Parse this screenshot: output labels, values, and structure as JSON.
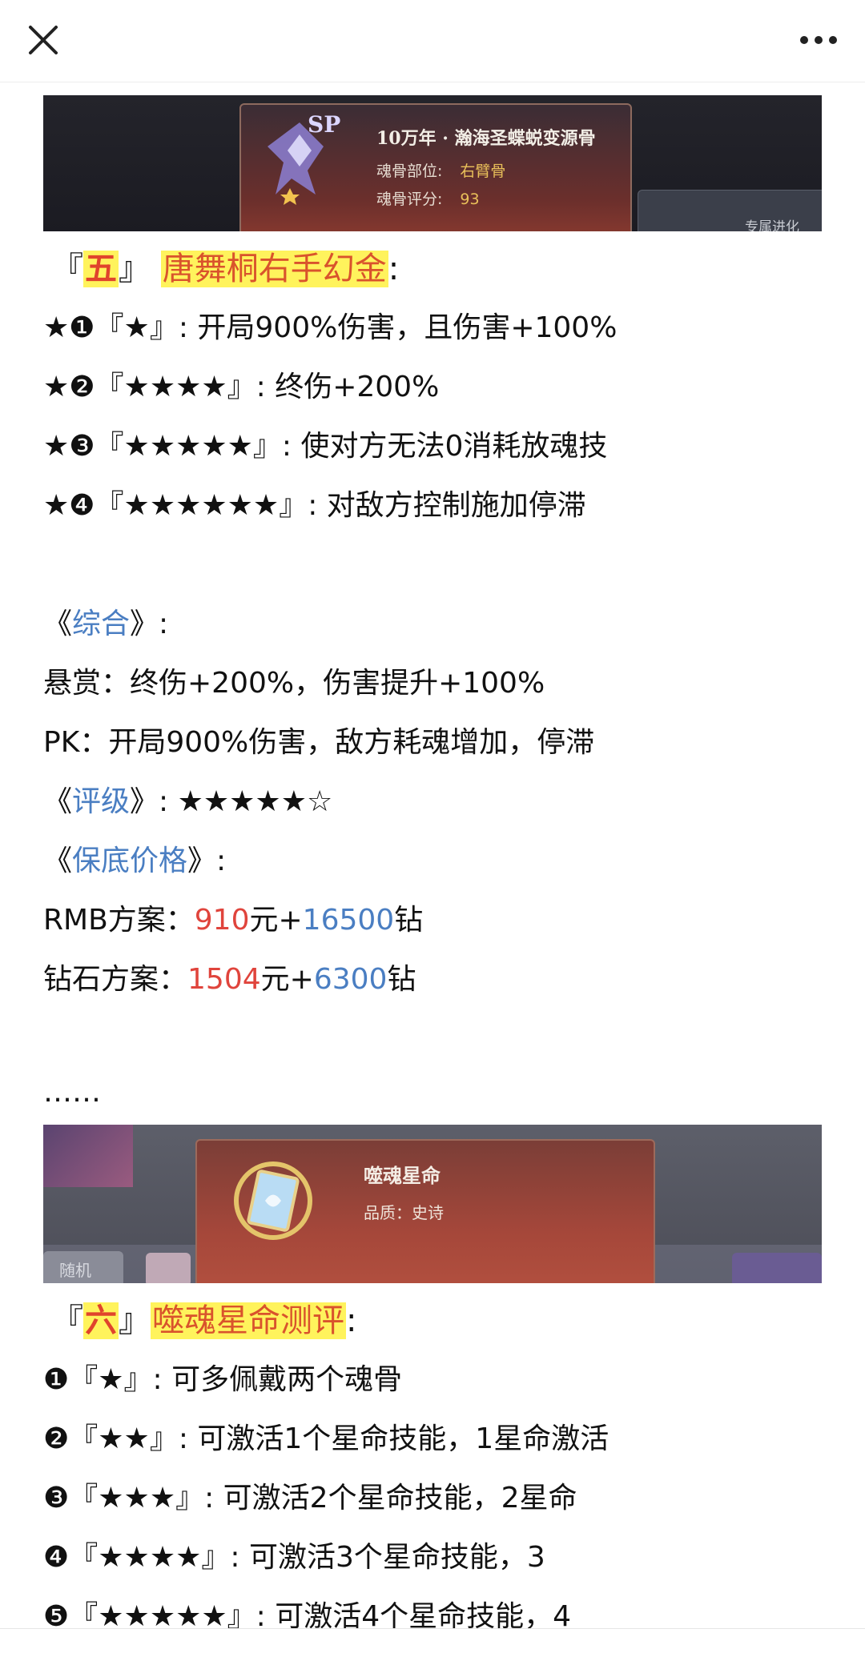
{
  "toolbar": {
    "close_icon": "close-icon",
    "more_icon": "more-icon"
  },
  "banner1": {
    "badge": "SP",
    "title": "10万年 · 瀚海圣蝶蜕变源骨",
    "part_label": "魂骨部位:",
    "part_value": "右臂骨",
    "score_label": "魂骨评分:",
    "score_value": "93",
    "side_label": "专属进化"
  },
  "section5": {
    "open": "『",
    "num": "五",
    "close": "』",
    "name": "唐舞桐右手幻金",
    "colon": ":",
    "items": [
      "★❶『★』: 开局900%伤害，且伤害+100%",
      "★❷『★★★★』: 终伤+200%",
      "★❸『★★★★★』: 使对方无法0消耗放魂技",
      "★❹『★★★★★★』: 对敌方控制施加停滞"
    ]
  },
  "summary": {
    "title_open": "《",
    "title": "综合",
    "title_close": "》:",
    "bounty": "悬赏：终伤+200%，伤害提升+100%",
    "pk": "PK：开局900%伤害，敌方耗魂增加，停滞",
    "rating_open": "《",
    "rating_title": "评级",
    "rating_close": "》: ",
    "rating_stars": "★★★★★☆",
    "price_open": "《",
    "price_title": "保底价格",
    "price_close": "》:",
    "rmb_label": "RMB方案：",
    "rmb_yuan": "910",
    "rmb_mid": "元+",
    "rmb_diamond": "16500",
    "rmb_end": "钻",
    "dia_label": "钻石方案：",
    "dia_yuan": "1504",
    "dia_mid": "元+",
    "dia_diamond": "6300",
    "dia_end": "钻"
  },
  "ellipsis": "……",
  "banner2": {
    "title": "噬魂星命",
    "quality": "品质：史诗",
    "small_btn": "随机"
  },
  "section6": {
    "open": "『",
    "num": "六",
    "close": "』",
    "name": "噬魂星命测评",
    "colon": ":",
    "items": [
      "❶『★』: 可多佩戴两个魂骨",
      "❷『★★』: 可激活1个星命技能，1星命激活",
      "❸『★★★』: 可激活2个星命技能，2星命",
      "❹『★★★★』: 可激活3个星命技能，3"
    ],
    "partial": "❺『★★★★★』: 可激活4个星命技能，4"
  }
}
